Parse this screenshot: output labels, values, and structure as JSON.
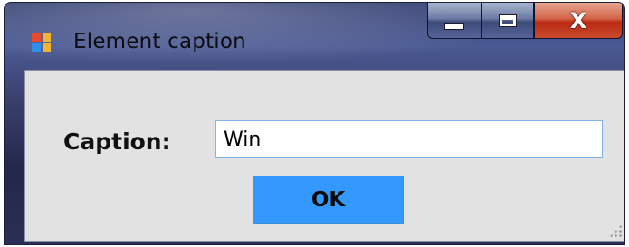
{
  "window": {
    "title": "Element caption",
    "buttons": {
      "minimize": "minimize",
      "maximize": "maximize",
      "close_glyph": "X"
    }
  },
  "form": {
    "caption_label": "Caption:",
    "caption_value": "Win",
    "ok_label": "OK"
  },
  "colors": {
    "ok_button": "#3399ff",
    "client_background": "#e2e2e2",
    "close_button": "#c84a2e"
  },
  "icons": {
    "app": "windows-form-icon",
    "minimize": "minimize-icon",
    "maximize": "maximize-icon",
    "close": "close-icon",
    "resize": "resize-grip-icon"
  }
}
